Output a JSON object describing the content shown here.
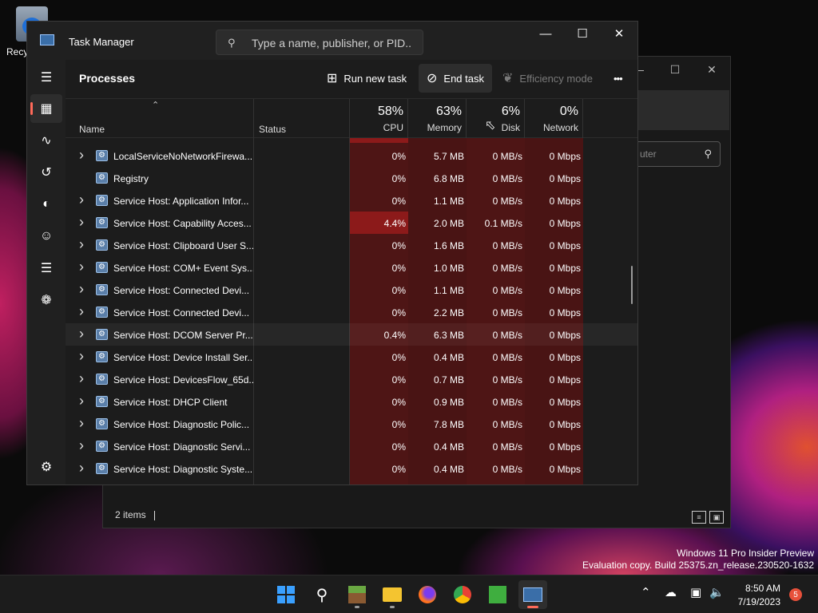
{
  "desktop": {
    "recycle_bin_label": "Recy"
  },
  "explorer": {
    "search_placeholder": "uter",
    "status_items": "2 items"
  },
  "task_manager": {
    "title": "Task Manager",
    "search_placeholder": "Type a name, publisher, or PID...",
    "page_title": "Processes",
    "toolbar": {
      "run_new_task": "Run new task",
      "end_task": "End task",
      "efficiency_mode": "Efficiency mode",
      "more": "•••"
    },
    "columns": {
      "name": "Name",
      "status": "Status",
      "cpu": {
        "label": "CPU",
        "percent": "58%"
      },
      "memory": {
        "label": "Memory",
        "percent": "63%"
      },
      "disk": {
        "label": "Disk",
        "percent": "6%"
      },
      "network": {
        "label": "Network",
        "percent": "0%"
      }
    },
    "rows": [
      {
        "name": "LocalServiceNoNetworkFirewa...",
        "expandable": true,
        "cpu": "0%",
        "memory": "5.7 MB",
        "disk": "0 MB/s",
        "network": "0 Mbps"
      },
      {
        "name": "Registry",
        "expandable": false,
        "cpu": "0%",
        "memory": "6.8 MB",
        "disk": "0 MB/s",
        "network": "0 Mbps"
      },
      {
        "name": "Service Host: Application Infor...",
        "expandable": true,
        "cpu": "0%",
        "memory": "1.1 MB",
        "disk": "0 MB/s",
        "network": "0 Mbps"
      },
      {
        "name": "Service Host: Capability Acces...",
        "expandable": true,
        "cpu": "4.4%",
        "memory": "2.0 MB",
        "disk": "0.1 MB/s",
        "network": "0 Mbps"
      },
      {
        "name": "Service Host: Clipboard User S...",
        "expandable": true,
        "cpu": "0%",
        "memory": "1.6 MB",
        "disk": "0 MB/s",
        "network": "0 Mbps"
      },
      {
        "name": "Service Host: COM+ Event Sys...",
        "expandable": true,
        "cpu": "0%",
        "memory": "1.0 MB",
        "disk": "0 MB/s",
        "network": "0 Mbps"
      },
      {
        "name": "Service Host: Connected Devi...",
        "expandable": true,
        "cpu": "0%",
        "memory": "1.1 MB",
        "disk": "0 MB/s",
        "network": "0 Mbps"
      },
      {
        "name": "Service Host: Connected Devi...",
        "expandable": true,
        "cpu": "0%",
        "memory": "2.2 MB",
        "disk": "0 MB/s",
        "network": "0 Mbps"
      },
      {
        "name": "Service Host: DCOM Server Pr...",
        "expandable": true,
        "cpu": "0.4%",
        "memory": "6.3 MB",
        "disk": "0 MB/s",
        "network": "0 Mbps"
      },
      {
        "name": "Service Host: Device Install Ser...",
        "expandable": true,
        "cpu": "0%",
        "memory": "0.4 MB",
        "disk": "0 MB/s",
        "network": "0 Mbps"
      },
      {
        "name": "Service Host: DevicesFlow_65d...",
        "expandable": true,
        "cpu": "0%",
        "memory": "0.7 MB",
        "disk": "0 MB/s",
        "network": "0 Mbps"
      },
      {
        "name": "Service Host: DHCP Client",
        "expandable": true,
        "cpu": "0%",
        "memory": "0.9 MB",
        "disk": "0 MB/s",
        "network": "0 Mbps"
      },
      {
        "name": "Service Host: Diagnostic Polic...",
        "expandable": true,
        "cpu": "0%",
        "memory": "7.8 MB",
        "disk": "0 MB/s",
        "network": "0 Mbps"
      },
      {
        "name": "Service Host: Diagnostic Servi...",
        "expandable": true,
        "cpu": "0%",
        "memory": "0.4 MB",
        "disk": "0 MB/s",
        "network": "0 Mbps"
      },
      {
        "name": "Service Host: Diagnostic Syste...",
        "expandable": true,
        "cpu": "0%",
        "memory": "0.4 MB",
        "disk": "0 MB/s",
        "network": "0 Mbps"
      }
    ],
    "sidebar_icons": [
      "hamburger-menu-icon",
      "processes-icon",
      "performance-icon",
      "app-history-icon",
      "startup-apps-icon",
      "users-icon",
      "details-icon",
      "services-icon",
      "settings-icon"
    ]
  },
  "watermark": {
    "line1": "Windows 11 Pro Insider Preview",
    "line2": "Evaluation copy. Build 25375.zn_release.230520-1632"
  },
  "taskbar": {
    "apps": [
      "start-icon",
      "search-icon",
      "minecraft-icon",
      "file-explorer-icon",
      "firefox-icon",
      "chrome-icon",
      "creeper-icon",
      "task-manager-icon"
    ],
    "time": "8:50 AM",
    "date": "7/19/2023",
    "notification_count": "5"
  },
  "colors": {
    "accent": "#ff6a5a",
    "heat_low": "#4e1515",
    "heat_high": "#8c1a1a"
  }
}
